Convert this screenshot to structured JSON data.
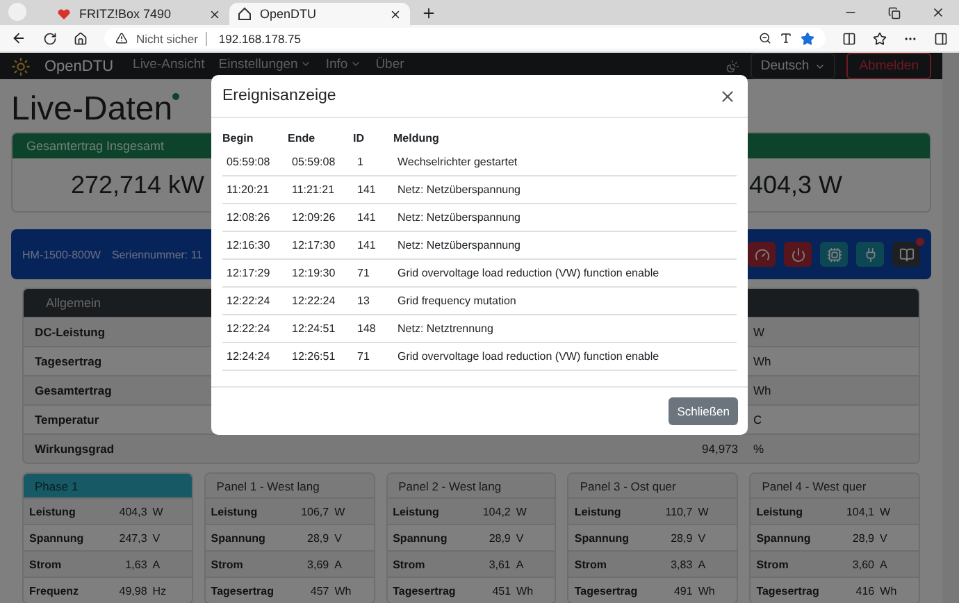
{
  "browser": {
    "tabs": [
      {
        "title": "FRITZ!Box 7490",
        "selected": false
      },
      {
        "title": "OpenDTU",
        "selected": true
      }
    ],
    "address": {
      "security": "Nicht sicher",
      "url": "192.168.178.75"
    }
  },
  "navbar": {
    "brand": "OpenDTU",
    "items": [
      {
        "label": "Live-Ansicht",
        "dropdown": false
      },
      {
        "label": "Einstellungen",
        "dropdown": true
      },
      {
        "label": "Info",
        "dropdown": true
      },
      {
        "label": "Über",
        "dropdown": false
      }
    ],
    "language": "Deutsch",
    "logout": "Abmelden"
  },
  "page": {
    "title": "Live-Daten",
    "total": {
      "header": "Gesamtertrag Insgesamt",
      "values": [
        "272,714 kW",
        "404,3 W"
      ]
    },
    "inverter": {
      "model": "HM-1500-800W",
      "serial": "Seriennummer: 11",
      "buttons": [
        {
          "kind": "gauge",
          "badge": false
        },
        {
          "kind": "power",
          "badge": false
        },
        {
          "kind": "chip",
          "badge": false
        },
        {
          "kind": "plug",
          "badge": false
        },
        {
          "kind": "journal",
          "badge": true
        }
      ]
    },
    "general": {
      "header": "Allgemein",
      "rows": [
        {
          "label": "DC-Leistung",
          "unit": "W"
        },
        {
          "label": "Tagesertrag",
          "unit": "Wh"
        },
        {
          "label": "Gesamtertrag",
          "unit": "Wh"
        },
        {
          "label": "Temperatur",
          "unit": "C"
        },
        {
          "label": "Wirkungsgrad",
          "value": "94,973",
          "unit": "%"
        }
      ]
    },
    "panels": [
      {
        "title": "Phase 1",
        "kind": "ac",
        "rows": [
          [
            "Leistung",
            "404,3",
            "W"
          ],
          [
            "Spannung",
            "247,3",
            "V"
          ],
          [
            "Strom",
            "1,63",
            "A"
          ],
          [
            "Frequenz",
            "49,98",
            "Hz"
          ]
        ]
      },
      {
        "title": "Panel 1 - West lang",
        "kind": "dc",
        "rows": [
          [
            "Leistung",
            "106,7",
            "W"
          ],
          [
            "Spannung",
            "28,9",
            "V"
          ],
          [
            "Strom",
            "3,69",
            "A"
          ],
          [
            "Tagesertrag",
            "457",
            "Wh"
          ]
        ]
      },
      {
        "title": "Panel 2 - West lang",
        "kind": "dc",
        "rows": [
          [
            "Leistung",
            "104,2",
            "W"
          ],
          [
            "Spannung",
            "28,9",
            "V"
          ],
          [
            "Strom",
            "3,61",
            "A"
          ],
          [
            "Tagesertrag",
            "451",
            "Wh"
          ]
        ]
      },
      {
        "title": "Panel 3 - Ost quer",
        "kind": "dc",
        "rows": [
          [
            "Leistung",
            "110,7",
            "W"
          ],
          [
            "Spannung",
            "28,9",
            "V"
          ],
          [
            "Strom",
            "3,83",
            "A"
          ],
          [
            "Tagesertrag",
            "491",
            "Wh"
          ]
        ]
      },
      {
        "title": "Panel 4 - West quer",
        "kind": "dc",
        "rows": [
          [
            "Leistung",
            "104,1",
            "W"
          ],
          [
            "Spannung",
            "28,9",
            "V"
          ],
          [
            "Strom",
            "3,60",
            "A"
          ],
          [
            "Tagesertrag",
            "416",
            "Wh"
          ]
        ]
      }
    ]
  },
  "modal": {
    "title": "Ereignisanzeige",
    "columns": [
      "Begin",
      "Ende",
      "ID",
      "Meldung"
    ],
    "rows": [
      [
        "05:59:08",
        "05:59:08",
        "1",
        "Wechselrichter gestartet"
      ],
      [
        "11:20:21",
        "11:21:21",
        "141",
        "Netz: Netzüberspannung"
      ],
      [
        "12:08:26",
        "12:09:26",
        "141",
        "Netz: Netzüberspannung"
      ],
      [
        "12:16:30",
        "12:17:30",
        "141",
        "Netz: Netzüberspannung"
      ],
      [
        "12:17:29",
        "12:19:30",
        "71",
        "Grid overvoltage load reduction (VW) function enable"
      ],
      [
        "12:22:24",
        "12:22:24",
        "13",
        "Grid frequency mutation"
      ],
      [
        "12:22:24",
        "12:24:51",
        "148",
        "Netz: Netztrennung"
      ],
      [
        "12:24:24",
        "12:26:51",
        "71",
        "Grid overvoltage load reduction (VW) function enable"
      ]
    ],
    "close_button": "Schließen"
  }
}
